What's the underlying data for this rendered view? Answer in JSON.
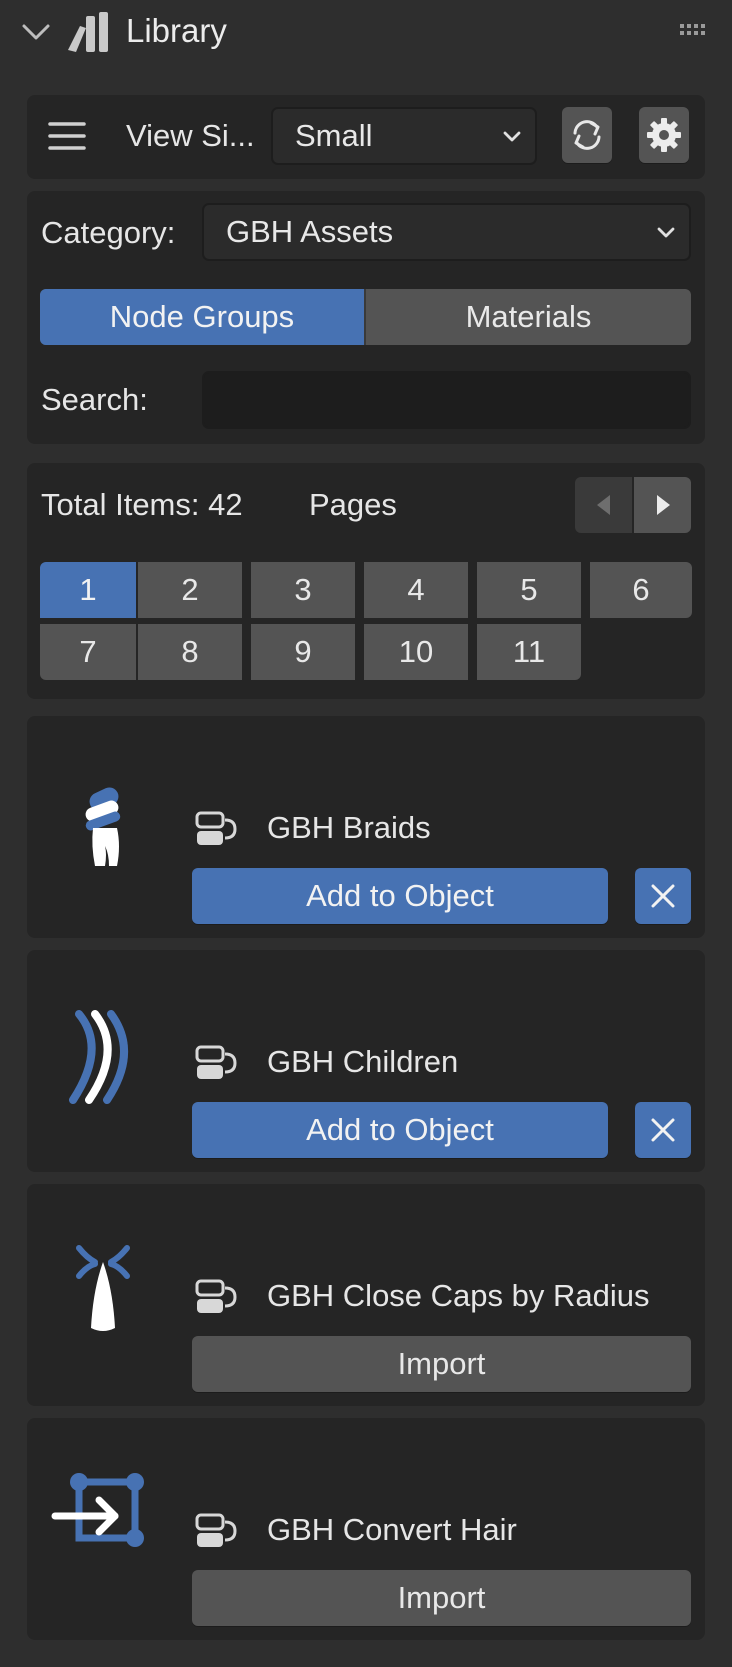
{
  "header": {
    "title": "Library",
    "icons": {
      "collapse": "chevron-down-icon",
      "library": "library-books-icon",
      "grip": "drag-grip-icon"
    }
  },
  "toolbar": {
    "view_size_label": "View Si...",
    "view_size_value": "Small",
    "icons": {
      "menu": "hamburger-menu-icon",
      "refresh": "refresh-icon",
      "settings": "gear-icon"
    }
  },
  "filters": {
    "category_label": "Category:",
    "category_value": "GBH Assets",
    "tabs": [
      {
        "label": "Node Groups",
        "active": true
      },
      {
        "label": "Materials",
        "active": false
      }
    ],
    "search_label": "Search:",
    "search_value": ""
  },
  "pagination": {
    "total_items_text": "Total Items: 42",
    "pages_label": "Pages",
    "pages": [
      "1",
      "2",
      "3",
      "4",
      "5",
      "6",
      "7",
      "8",
      "9",
      "10",
      "11"
    ],
    "current_page": "1",
    "icons": {
      "prev": "triangle-left-icon",
      "next": "triangle-right-icon"
    }
  },
  "assets": [
    {
      "name": "GBH Braids",
      "icon": "braids-icon",
      "action": "Add to Object",
      "removable": true
    },
    {
      "name": "GBH Children",
      "icon": "children-curves-icon",
      "action": "Add to Object",
      "removable": true
    },
    {
      "name": "GBH Close Caps by Radius",
      "icon": "close-caps-icon",
      "action": "Import",
      "removable": false
    },
    {
      "name": "GBH Convert Hair",
      "icon": "convert-hair-icon",
      "action": "Import",
      "removable": false
    }
  ],
  "colors": {
    "background": "#2e2e2e",
    "panel": "#252525",
    "accent": "#4772b3",
    "button": "#545454",
    "text": "#e6e6e6"
  }
}
